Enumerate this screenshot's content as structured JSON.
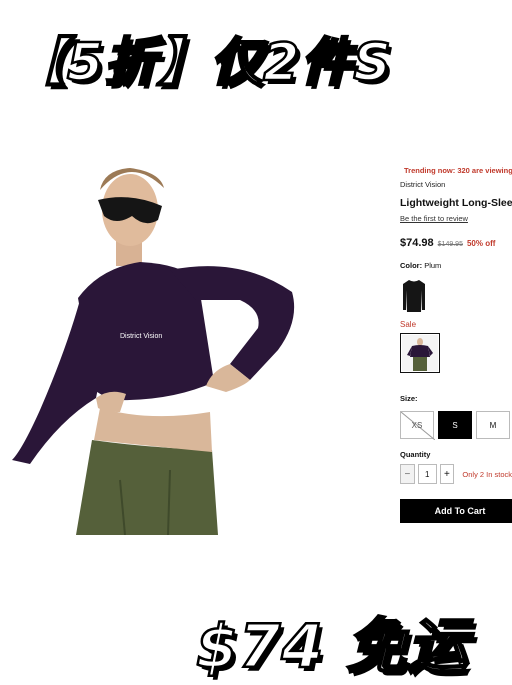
{
  "promo": {
    "top_text": "【5折】仅2件S",
    "bottom_text": "$74 免运"
  },
  "product": {
    "trending_text": "Trending now: 320 are viewing",
    "brand": "District Vision",
    "title": "Lightweight Long-Sleeve",
    "review_link": "Be the first to review",
    "price": "$74.98",
    "original_price": "$149.95",
    "discount": "50% off",
    "color_key": "Color:",
    "color_value": "Plum",
    "sale_label": "Sale",
    "size_label": "Size:",
    "sizes": [
      {
        "label": "XS",
        "state": "unavailable"
      },
      {
        "label": "S",
        "state": "selected"
      },
      {
        "label": "M",
        "state": "available"
      }
    ],
    "quantity_label": "Quantity",
    "quantity_minus": "−",
    "quantity_value": "1",
    "quantity_plus": "+",
    "stock_text": "Only 2 In stock",
    "add_to_cart": "Add To Cart"
  },
  "colors": {
    "accent_red": "#c0392b",
    "top_plum": "#2a1638",
    "pants_olive": "#55603a",
    "button_black": "#000000"
  },
  "icons": {
    "trending": "flame-icon",
    "minus": "minus-icon",
    "plus": "plus-icon"
  }
}
